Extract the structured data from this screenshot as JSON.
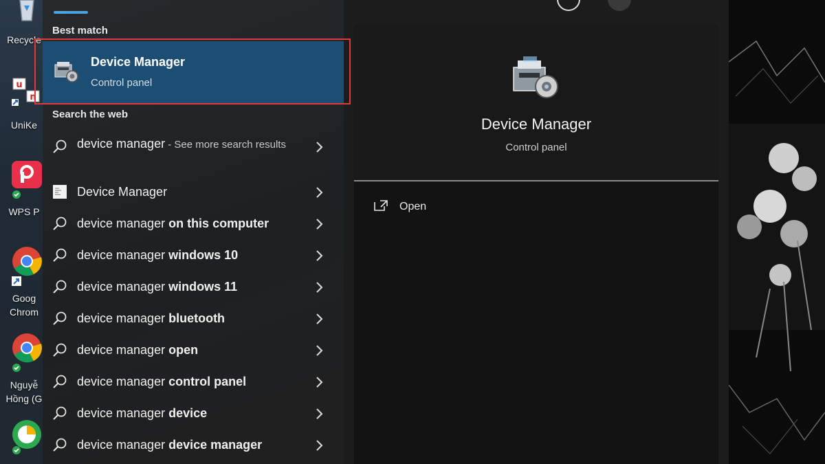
{
  "desktop": {
    "icons": [
      {
        "name": "recycle-bin",
        "label": "Recycle"
      },
      {
        "name": "unikey",
        "label": "UniKe"
      },
      {
        "name": "wps",
        "label": "WPS P"
      },
      {
        "name": "google-chrome",
        "label_line1": "Goog",
        "label_line2": "Chrom"
      },
      {
        "name": "chrome-profile",
        "label_line1": "Nguyễ",
        "label_line2": "Hồng (G"
      }
    ]
  },
  "search": {
    "best_match_header": "Best match",
    "best_match": {
      "title": "Device Manager",
      "subtitle": "Control panel",
      "icon": "device-manager-icon"
    },
    "web_header": "Search the web",
    "web_results": [
      {
        "type": "search",
        "prefix": "device manager",
        "bold": "",
        "suffix": " - See more search results"
      },
      {
        "type": "app",
        "prefix": "Device Manager",
        "bold": "",
        "suffix": ""
      },
      {
        "type": "search",
        "prefix": "device manager ",
        "bold": "on this computer",
        "suffix": ""
      },
      {
        "type": "search",
        "prefix": "device manager ",
        "bold": "windows 10",
        "suffix": ""
      },
      {
        "type": "search",
        "prefix": "device manager ",
        "bold": "windows 11",
        "suffix": ""
      },
      {
        "type": "search",
        "prefix": "device manager ",
        "bold": "bluetooth",
        "suffix": ""
      },
      {
        "type": "search",
        "prefix": "device manager ",
        "bold": "open",
        "suffix": ""
      },
      {
        "type": "search",
        "prefix": "device manager ",
        "bold": "control panel",
        "suffix": ""
      },
      {
        "type": "search",
        "prefix": "device manager ",
        "bold": "device",
        "suffix": ""
      },
      {
        "type": "search",
        "prefix": "device manager ",
        "bold": "device manager",
        "suffix": ""
      }
    ]
  },
  "preview": {
    "title": "Device Manager",
    "subtitle": "Control panel",
    "open_label": "Open"
  },
  "colors": {
    "accent": "#4aa3e0",
    "selected_bg": "#1c4e74",
    "highlight_frame": "#e03a3a"
  }
}
